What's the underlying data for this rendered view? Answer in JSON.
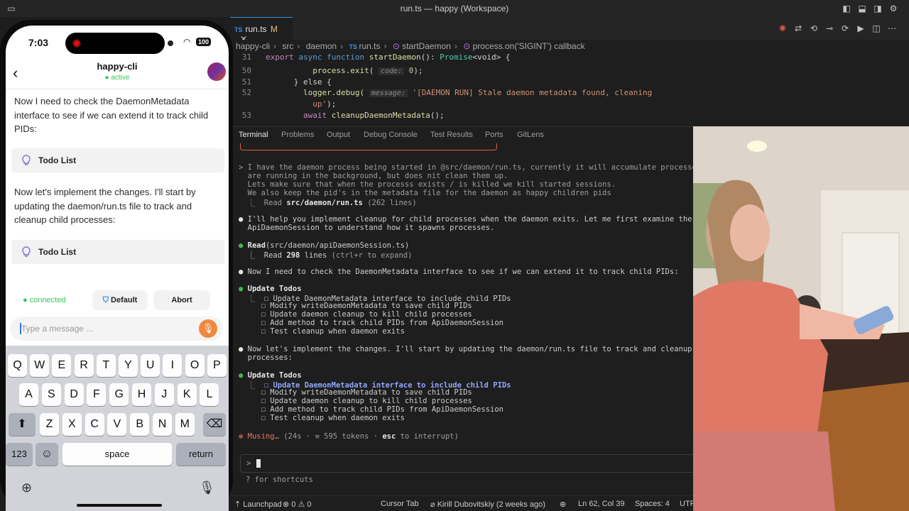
{
  "window": {
    "title": "run.ts — happy (Workspace)"
  },
  "editor": {
    "tab": {
      "lang": "TS",
      "name": "run.ts",
      "modified": "M",
      "close": "✕"
    },
    "breadcrumb": [
      "happy-cli",
      "src",
      "daemon",
      "run.ts",
      "startDaemon",
      "process.on('SIGINT') callback"
    ],
    "code": {
      "l31": {
        "num": "31",
        "kw1": "export",
        "kw2": "async",
        "kw3": "function",
        "fn": "startDaemon",
        "rest": "(): ",
        "ty": "Promise",
        "rest2": "<void> {"
      },
      "l50": {
        "num": "50",
        "fn": "process.exit(",
        "hint": "code:",
        "val": " 0",
        "rest": ");"
      },
      "l51": {
        "num": "51",
        "text": "} else {"
      },
      "l52": {
        "num": "52",
        "fn": "logger.debug(",
        "hint": "message:",
        "str": " '[DAEMON RUN] Stale daemon metadata found, cleaning",
        "str2": "up'",
        "rest2": ");"
      },
      "l53": {
        "num": "53",
        "kw": "await",
        "fn": " cleanupDaemonMetadata",
        "rest": "();"
      }
    }
  },
  "panel": {
    "tabs": [
      "Terminal",
      "Problems",
      "Output",
      "Debug Console",
      "Test Results",
      "Ports",
      "GitLens"
    ],
    "terminal": {
      "prompt_lines": [
        "> I have the daemon process being started in @src/daemon/run.ts, currently it will accumulate processes tha",
        "  are running in the background, but does nit clean them up.",
        "  Lets make sure that when the processs exists / is killed we kill started sessions.",
        "  We also keep the pid's in the metadata file for the daemon as happy children pids"
      ],
      "read1": {
        "prefix": "  ⎿  Read ",
        "file": "src/daemon/run.ts",
        "suffix": " (262 lines)"
      },
      "msg1": [
        "I'll help you implement cleanup for child processes when the daemon exits. Let me first examine the",
        "  ApiDaemonSession to understand how it spawns processes."
      ],
      "read2": {
        "label": "Read",
        "arg": "(src/daemon/apiDaemonSession.ts)",
        "pre": "  ⎿  Read ",
        "count": "298",
        "mid": " lines ",
        "hint": "(ctrl+r to expand)"
      },
      "msg2": "Now I need to check the DaemonMetadata interface to see if we can extend it to track child PIDs:",
      "todos_title": "Update Todos",
      "todos1": [
        "☐ Update DaemonMetadata interface to include child PIDs",
        "☐ Modify writeDaemonMetadata to save child PIDs",
        "☐ Update daemon cleanup to kill child processes",
        "☐ Add method to track child PIDs from ApiDaemonSession",
        "☐ Test cleanup when daemon exits"
      ],
      "msg3": [
        "Now let's implement the changes. I'll start by updating the daemon/run.ts file to track and cleanup chilc",
        "  processes:"
      ],
      "todos2": [
        "☐ Update DaemonMetadata interface to include child PIDs",
        "☐ Modify writeDaemonMetadata to save child PIDs",
        "☐ Update daemon cleanup to kill child processes",
        "☐ Add method to track child PIDs from ApiDaemonSession",
        "☐ Test cleanup when daemon exits"
      ],
      "status": {
        "star": "✻",
        "word": " Musing… ",
        "detail": "(24s · ⚒ 595 tokens · ",
        "esc": "esc",
        "end": " to interrupt)"
      },
      "input_prompt": ">",
      "shortcuts": "? for shortcuts"
    }
  },
  "statusbar": {
    "launchpad": "Launchpad",
    "errors": "⊗ 0 ⚠ 0",
    "cursor_tab": "Cursor Tab",
    "blame": "Kirill Dubovitskiy (2 weeks ago)",
    "position": "Ln 62, Col 39",
    "spaces": "Spaces: 4",
    "encoding": "UTF"
  },
  "phone": {
    "time": "7:03",
    "battery": "100",
    "chat_title": "happy-cli",
    "chat_status": "active",
    "messages": [
      "Now I need to check the DaemonMetadata interface to see if we can extend it to track child PIDs:",
      "Now let's implement the changes. I'll start by updating the daemon/run.ts file to track and cleanup child processes:"
    ],
    "todo_label": "Todo List",
    "connection": "connected",
    "mode": "Default",
    "abort": "Abort",
    "input_placeholder": "Type a message ...",
    "keyboard": {
      "row1": [
        "Q",
        "W",
        "E",
        "R",
        "T",
        "Y",
        "U",
        "I",
        "O",
        "P"
      ],
      "row2": [
        "A",
        "S",
        "D",
        "F",
        "G",
        "H",
        "J",
        "K",
        "L"
      ],
      "row3": [
        "Z",
        "X",
        "C",
        "V",
        "B",
        "N",
        "M"
      ],
      "num": "123",
      "space": "space",
      "return": "return"
    }
  },
  "colors": {
    "accent": "#3c8dde",
    "connected": "#34c759",
    "mic": "#f0883e"
  }
}
